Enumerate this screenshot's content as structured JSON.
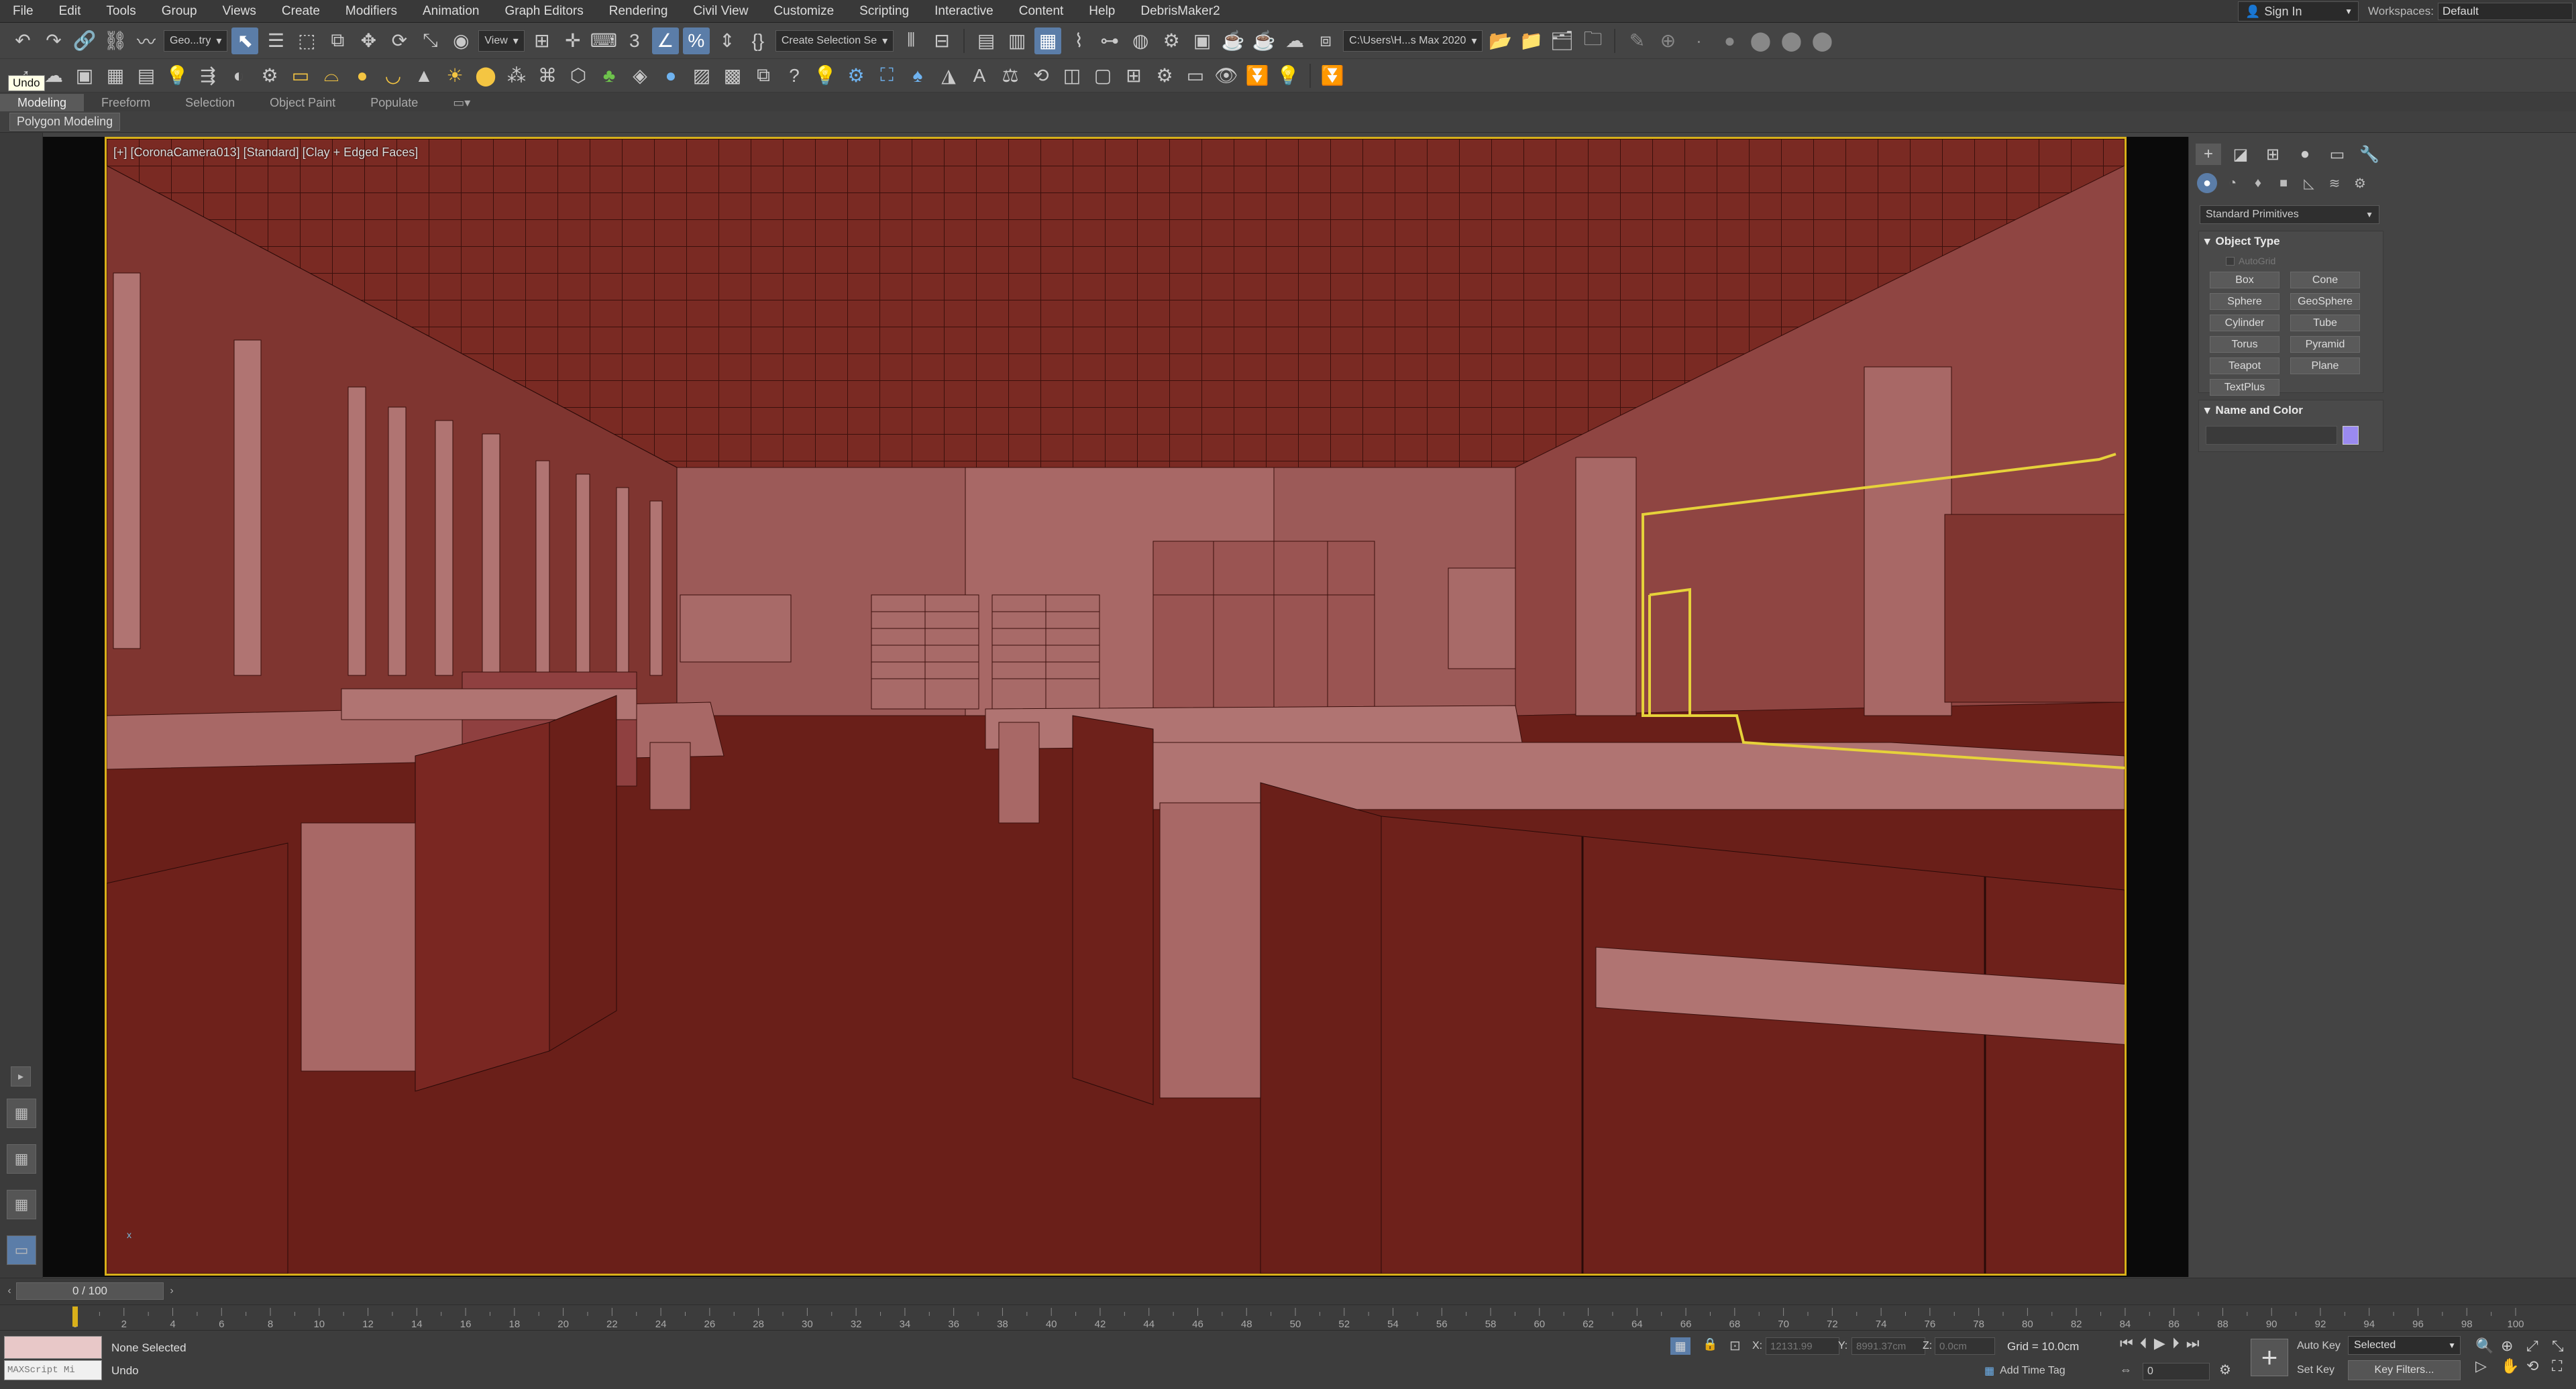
{
  "menu": [
    "File",
    "Edit",
    "Tools",
    "Group",
    "Views",
    "Create",
    "Modifiers",
    "Animation",
    "Graph Editors",
    "Rendering",
    "Civil View",
    "Customize",
    "Scripting",
    "Interactive",
    "Content",
    "Help",
    "DebrisMaker2"
  ],
  "signin_label": "Sign In",
  "workspaces_label": "Workspaces:",
  "workspace_value": "Default",
  "toolbar": {
    "selection_filter": "Geo...try",
    "ref_coord": "View",
    "named_selection": "Create Selection Se",
    "project_path": "C:\\Users\\H...s Max 2020",
    "undo_tooltip": "Undo"
  },
  "ribbon": {
    "tabs": [
      "Modeling",
      "Freeform",
      "Selection",
      "Object Paint",
      "Populate"
    ],
    "active_tab": "Modeling",
    "subtab": "Polygon Modeling"
  },
  "viewport": {
    "label": "[+] [CoronaCamera013] [Standard] [Clay + Edged Faces]",
    "clay_color": "#6a1f19",
    "selection_color": "#e6d23a",
    "axis_label": "x"
  },
  "command_panel": {
    "primitive_type": "Standard Primitives",
    "object_type_title": "Object Type",
    "autogrid_label": "AutoGrid",
    "primitives": [
      "Box",
      "Cone",
      "Sphere",
      "GeoSphere",
      "Cylinder",
      "Tube",
      "Torus",
      "Pyramid",
      "Teapot",
      "Plane",
      "TextPlus"
    ],
    "name_color_title": "Name and Color",
    "object_color": "#9a8af0"
  },
  "timeline": {
    "slider_text": "0 / 100",
    "ticks": [
      "0",
      "2",
      "4",
      "6",
      "8",
      "10",
      "12",
      "14",
      "16",
      "18",
      "20",
      "22",
      "24",
      "26",
      "28",
      "30",
      "32",
      "34",
      "36",
      "38",
      "40",
      "42",
      "44",
      "46",
      "48",
      "50",
      "52",
      "54",
      "56",
      "58",
      "60",
      "62",
      "64",
      "66",
      "68",
      "70",
      "72",
      "74",
      "76",
      "78",
      "80",
      "82",
      "84",
      "86",
      "88",
      "90",
      "92",
      "94",
      "96",
      "98",
      "100"
    ]
  },
  "status": {
    "maxscript_label": "MAXScript Mi",
    "selection_status": "None Selected",
    "prompt": "Undo",
    "x_label": "X:",
    "x_value": "12131.99",
    "y_label": "Y:",
    "y_value": "8991.37cm",
    "z_label": "Z:",
    "z_value": "0.0cm",
    "grid": "Grid = 10.0cm",
    "add_time_tag": "Add Time Tag",
    "frame_value": "0",
    "auto_key": "Auto Key",
    "set_key": "Set Key",
    "selected_dd": "Selected",
    "key_filters": "Key Filters..."
  }
}
